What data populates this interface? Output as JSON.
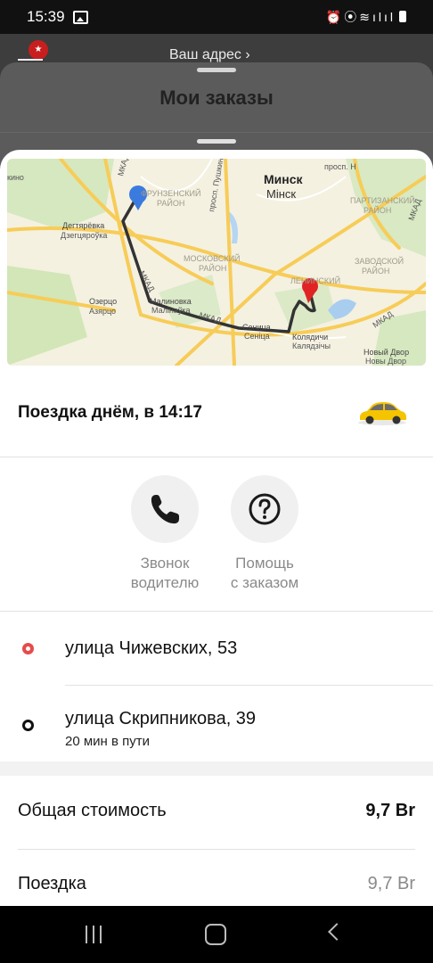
{
  "status_bar": {
    "time": "15:39",
    "icons": [
      "gallery-icon",
      "alarm-icon",
      "location-icon",
      "wifi-icon",
      "signal-icon",
      "signal-icon",
      "battery-icon"
    ]
  },
  "background": {
    "your_address": "Ваш адрес ›"
  },
  "orders_sheet": {
    "title": "Мои заказы"
  },
  "map": {
    "labels": {
      "city": "Минск",
      "city_by": "Мінск",
      "frunzensky": "ФРУНЗЕНСКИЙ",
      "rayon": "РАЙОН",
      "moskovsky": "МОСКОВСКИЙ",
      "partizansky": "ПАРТИЗАНСКИЙ",
      "zavodskoy": "ЗАВОДСКОЙ",
      "leninsky": "ЛЕНИНСКИЙ",
      "degtyarevka": "Дегтярёвка",
      "dzegtsyarouka": "Дзегцяроўка",
      "ozertso": "Озерцо",
      "azyartso": "Азярцо",
      "malinovka": "Малиновка",
      "malinauka": "Малінаўка",
      "senitsa": "Сеница",
      "senitsa_by": "Сеніца",
      "kolyadichi": "Колядичи",
      "kalyadzichy": "Калядзічы",
      "novy_dvor": "Новый Двор",
      "novy_dvor_by": "Новы Двор",
      "mkad": "МКАД",
      "pushkina": "просп. Пушкина",
      "prosp": "просп. Н",
      "kino": "кино"
    },
    "start_marker_color": "#3b7be0",
    "end_marker_color": "#e02424"
  },
  "trip": {
    "title": "Поездка днём, в 14:17",
    "car_color": "#f5c400"
  },
  "actions": [
    {
      "icon": "phone-icon",
      "label_line1": "Звонок",
      "label_line2": "водителю"
    },
    {
      "icon": "question-icon",
      "label_line1": "Помощь",
      "label_line2": "с заказом"
    }
  ],
  "route": {
    "from": "улица Чижевских, 53",
    "to": "улица Скрипникова, 39",
    "duration": "20 мин в пути"
  },
  "cost": {
    "total_label": "Общая стоимость",
    "total_value": "9,7 Br",
    "trip_label": "Поездка",
    "trip_value": "9,7 Br"
  },
  "nav": {
    "buttons": [
      "recent-apps-icon",
      "home-icon",
      "back-icon"
    ]
  }
}
